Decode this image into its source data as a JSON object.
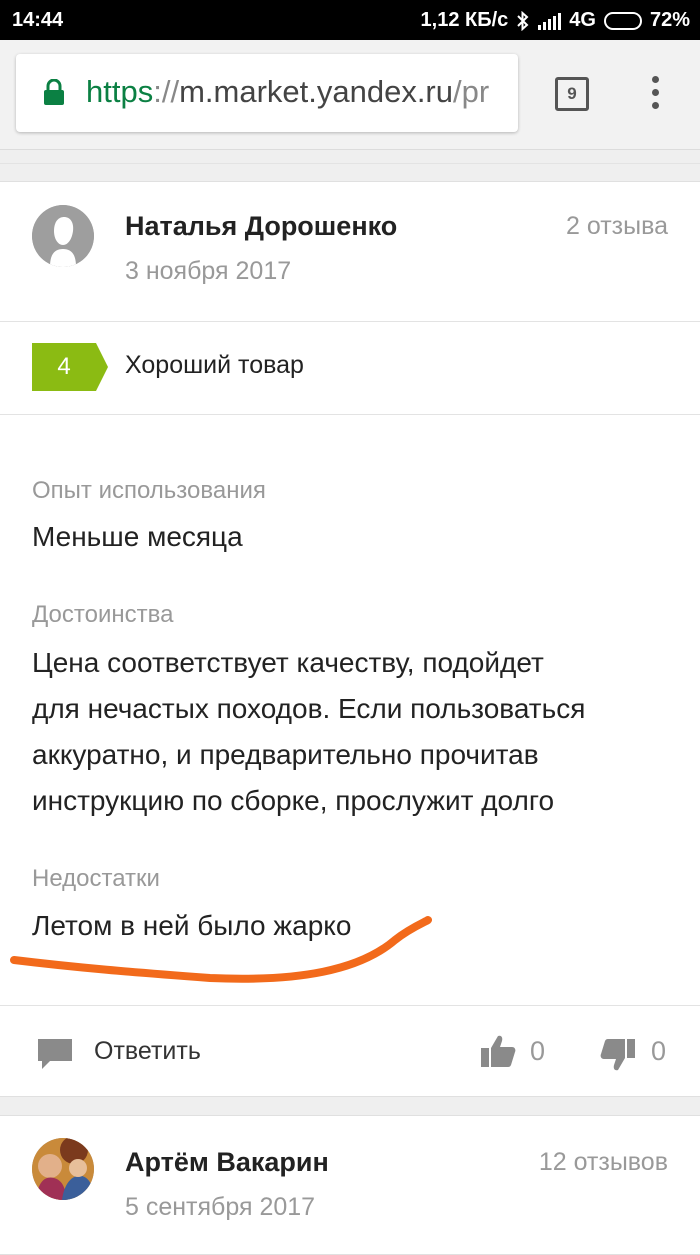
{
  "status_bar": {
    "time": "14:44",
    "speed": "1,12 КБ/с",
    "network": "4G",
    "battery": "72%",
    "battery_level": 0.72,
    "icons": [
      "bluetooth-icon",
      "signal-icon",
      "battery-icon"
    ]
  },
  "browser": {
    "url_scheme": "https",
    "url_separator": "://",
    "url_host": "m.market.yandex.ru",
    "url_path": "/pr",
    "tab_count": "9",
    "colors": {
      "secure": "#0b8043",
      "host": "#444444"
    }
  },
  "review1": {
    "author": "Наталья Дорошенко",
    "date": "3 ноября 2017",
    "reviews_count": "2 отзыва",
    "grade": "4",
    "grade_text": "Хороший товар",
    "grade_color": "#8bbb13",
    "experience_label": "Опыт использования",
    "experience_value": "Меньше месяца",
    "pros_label": "Достоинства",
    "pros_lines": [
      "Цена соответствует качеству, подойдет",
      "для нечастых походов. Если пользоваться",
      "аккуратно, и предварительно прочитав",
      "инструкцию по сборке, прослужит долго"
    ],
    "cons_label": "Недостатки",
    "cons_value": "Летом в ней было жарко",
    "annotation_color": "#f26a1b",
    "reply_label": "Ответить",
    "likes": "0",
    "dislikes": "0"
  },
  "review2": {
    "author": "Артём Вакарин",
    "date": "5 сентября 2017",
    "reviews_count": "12 отзывов"
  }
}
